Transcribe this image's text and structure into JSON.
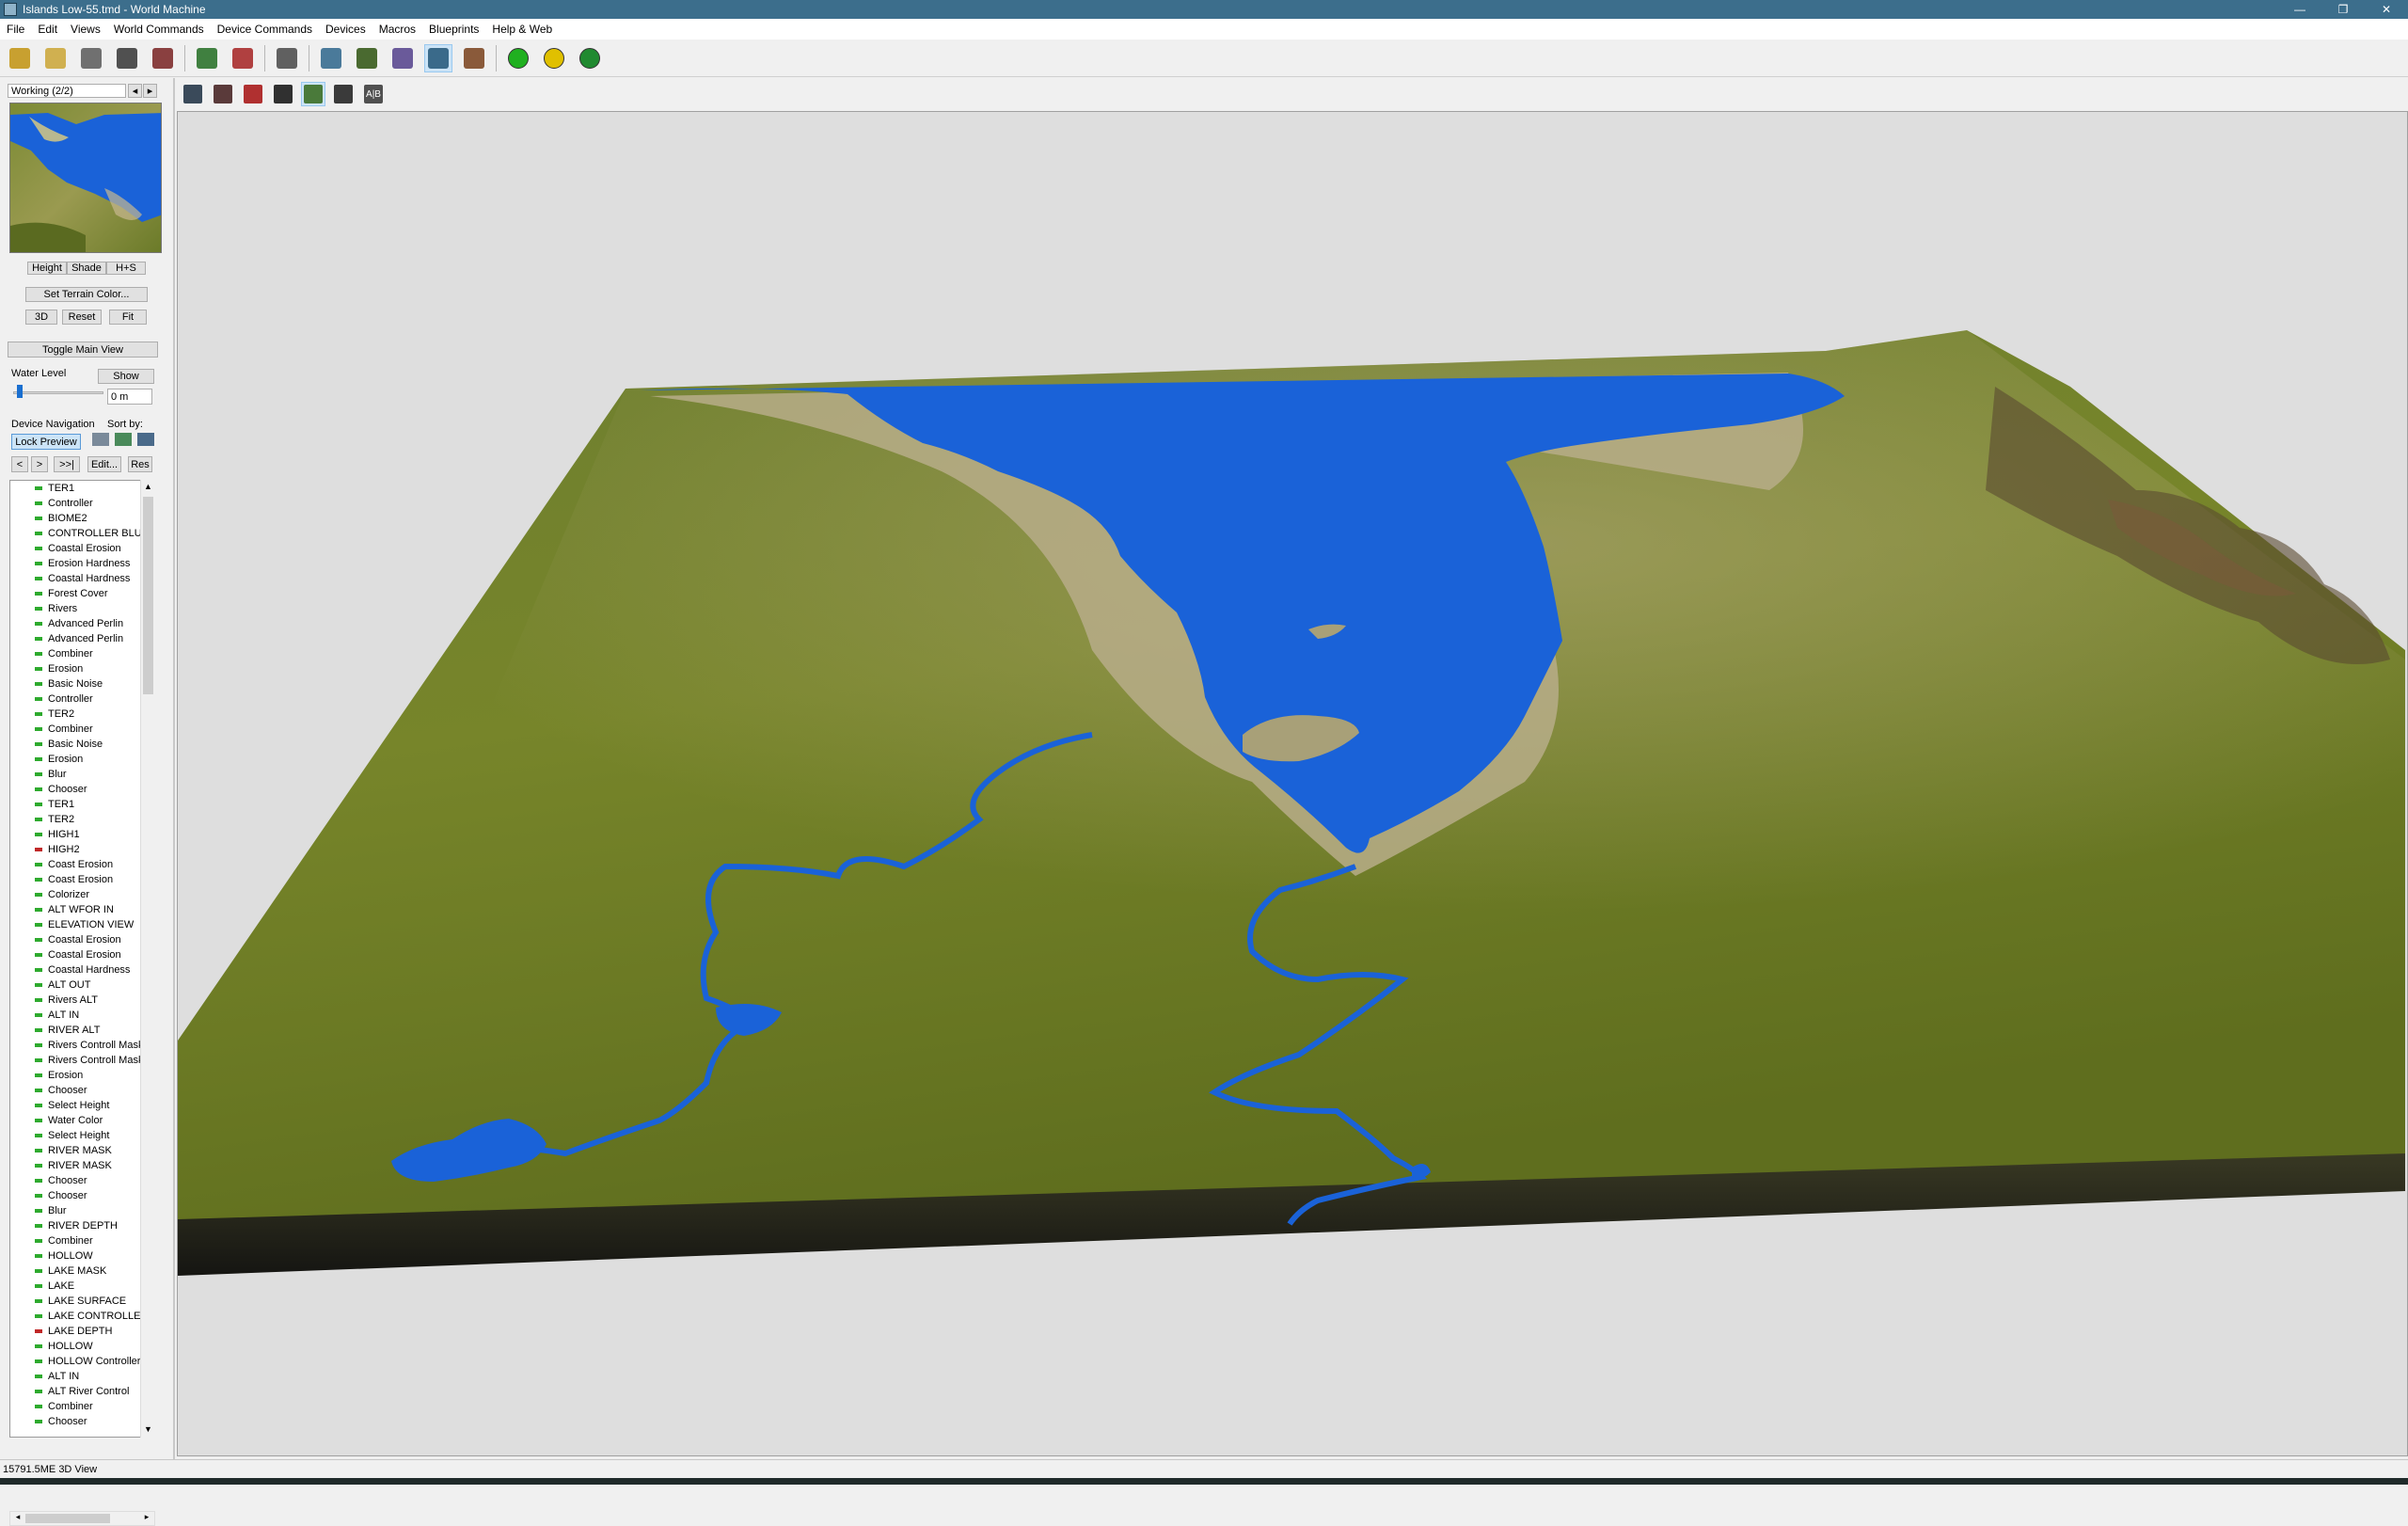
{
  "window": {
    "title": "Islands Low-55.tmd - World Machine",
    "controls": [
      "—",
      "❐",
      "✕"
    ]
  },
  "menu": [
    "File",
    "Edit",
    "Views",
    "World Commands",
    "Device Commands",
    "Devices",
    "Macros",
    "Blueprints",
    "Help & Web"
  ],
  "toolbar": {
    "icons": [
      {
        "name": "new-world-icon",
        "color": "#c8a030"
      },
      {
        "name": "open-icon",
        "color": "#d0b050"
      },
      {
        "name": "help-icon",
        "color": "#707070"
      },
      {
        "name": "save-icon",
        "color": "#505050"
      },
      {
        "name": "save-as-icon",
        "color": "#8a4040"
      },
      {
        "name": "device-view-icon",
        "color": "#408040"
      },
      {
        "name": "layout-view-icon",
        "color": "#b04040"
      },
      {
        "name": "build-settings-icon",
        "color": "#606060"
      },
      {
        "name": "world-settings-icon",
        "color": "#4a7a9a"
      },
      {
        "name": "terrain-grid-icon",
        "color": "#4a6a30"
      },
      {
        "name": "explorer-icon",
        "color": "#6a5a9a"
      },
      {
        "name": "3d-view-icon",
        "color": "#3a6a8a"
      },
      {
        "name": "texture-view-icon",
        "color": "#8a5a3a"
      },
      {
        "name": "build-green-icon",
        "color": "#20b020"
      },
      {
        "name": "build-yellow-icon",
        "color": "#e0c000"
      },
      {
        "name": "build-full-icon",
        "color": "#208a30"
      }
    ]
  },
  "viewtoolbar": {
    "icons": [
      {
        "name": "view-mode-icon-1",
        "color": "#3a4a5a"
      },
      {
        "name": "view-mode-icon-2",
        "color": "#5a3a3a"
      },
      {
        "name": "view-mode-icon-3",
        "color": "#b03030"
      },
      {
        "name": "camera-icon",
        "color": "#303030"
      },
      {
        "name": "slope-icon",
        "color": "#4a7a3a"
      },
      {
        "name": "help-view-icon",
        "color": "#3a3a3a"
      },
      {
        "name": "ab-compare-icon",
        "color": "#505050",
        "text": "A|B"
      }
    ]
  },
  "preview": {
    "selector": "Working (2/2)",
    "tabs": [
      "Height",
      "Shade",
      "H+S"
    ],
    "set_color": "Set Terrain Color...",
    "btn_3d": "3D",
    "btn_reset": "Reset",
    "btn_fit": "Fit",
    "toggle_main": "Toggle Main View",
    "water_label": "Water Level",
    "water_show": "Show",
    "water_value": "0 m",
    "nav_label": "Device Navigation",
    "sort_label": "Sort by:",
    "lock_preview": "Lock Preview",
    "nav_prev": "<",
    "nav_next": ">",
    "nav_last": ">>|",
    "nav_edit": "Edit...",
    "nav_res": "Res"
  },
  "devices": [
    {
      "name": "TER1",
      "status": "green"
    },
    {
      "name": "Controller",
      "status": "green"
    },
    {
      "name": "BIOME2",
      "status": "green"
    },
    {
      "name": "CONTROLLER BLU",
      "status": "green"
    },
    {
      "name": "Coastal Erosion",
      "status": "green"
    },
    {
      "name": "Erosion Hardness",
      "status": "green"
    },
    {
      "name": "Coastal Hardness",
      "status": "green"
    },
    {
      "name": "Forest Cover",
      "status": "green"
    },
    {
      "name": "Rivers",
      "status": "green"
    },
    {
      "name": "Advanced Perlin",
      "status": "green"
    },
    {
      "name": "Advanced Perlin",
      "status": "green"
    },
    {
      "name": "Combiner",
      "status": "green"
    },
    {
      "name": "Erosion",
      "status": "green"
    },
    {
      "name": "Basic Noise",
      "status": "green"
    },
    {
      "name": "Controller",
      "status": "green"
    },
    {
      "name": "TER2",
      "status": "green"
    },
    {
      "name": "Combiner",
      "status": "green"
    },
    {
      "name": "Basic Noise",
      "status": "green"
    },
    {
      "name": "Erosion",
      "status": "green"
    },
    {
      "name": "Blur",
      "status": "green"
    },
    {
      "name": "Chooser",
      "status": "green"
    },
    {
      "name": "TER1",
      "status": "green"
    },
    {
      "name": "TER2",
      "status": "green"
    },
    {
      "name": "HIGH1",
      "status": "green"
    },
    {
      "name": "HIGH2",
      "status": "red"
    },
    {
      "name": "Coast Erosion",
      "status": "green"
    },
    {
      "name": "Coast Erosion",
      "status": "green"
    },
    {
      "name": "Colorizer",
      "status": "green"
    },
    {
      "name": "ALT WFOR IN",
      "status": "green"
    },
    {
      "name": "ELEVATION VIEW",
      "status": "green"
    },
    {
      "name": "Coastal Erosion",
      "status": "green"
    },
    {
      "name": "Coastal Erosion",
      "status": "green"
    },
    {
      "name": "Coastal Hardness",
      "status": "green"
    },
    {
      "name": "ALT OUT",
      "status": "green"
    },
    {
      "name": "Rivers ALT",
      "status": "green"
    },
    {
      "name": "ALT IN",
      "status": "green"
    },
    {
      "name": "RIVER ALT",
      "status": "green"
    },
    {
      "name": "Rivers Controll Mask",
      "status": "green"
    },
    {
      "name": "Rivers Controll Mask",
      "status": "green"
    },
    {
      "name": "Erosion",
      "status": "green"
    },
    {
      "name": "Chooser",
      "status": "green"
    },
    {
      "name": "Select Height",
      "status": "green"
    },
    {
      "name": "Water Color",
      "status": "green"
    },
    {
      "name": "Select Height",
      "status": "green"
    },
    {
      "name": "RIVER MASK",
      "status": "green"
    },
    {
      "name": "RIVER MASK",
      "status": "green"
    },
    {
      "name": "Chooser",
      "status": "green"
    },
    {
      "name": "Chooser",
      "status": "green"
    },
    {
      "name": "Blur",
      "status": "green"
    },
    {
      "name": "RIVER DEPTH",
      "status": "green"
    },
    {
      "name": "Combiner",
      "status": "green"
    },
    {
      "name": "HOLLOW",
      "status": "green"
    },
    {
      "name": "LAKE MASK",
      "status": "green"
    },
    {
      "name": "LAKE",
      "status": "green"
    },
    {
      "name": "LAKE SURFACE",
      "status": "green"
    },
    {
      "name": "LAKE CONTROLLER",
      "status": "green"
    },
    {
      "name": "LAKE DEPTH",
      "status": "red"
    },
    {
      "name": "HOLLOW",
      "status": "green"
    },
    {
      "name": "HOLLOW Controller",
      "status": "green"
    },
    {
      "name": "ALT IN",
      "status": "green"
    },
    {
      "name": "ALT River Control",
      "status": "green"
    },
    {
      "name": "Combiner",
      "status": "green"
    },
    {
      "name": "Chooser",
      "status": "green"
    }
  ],
  "colors": {
    "terrain": "#6a7a28",
    "water": "#1a62d8",
    "title_bar": "#3c6e8c",
    "viewport_bg": "#dedede",
    "status_green": "#2eaa2e",
    "status_red": "#c02828"
  },
  "status": {
    "text": "15791.5ME 3D View"
  }
}
